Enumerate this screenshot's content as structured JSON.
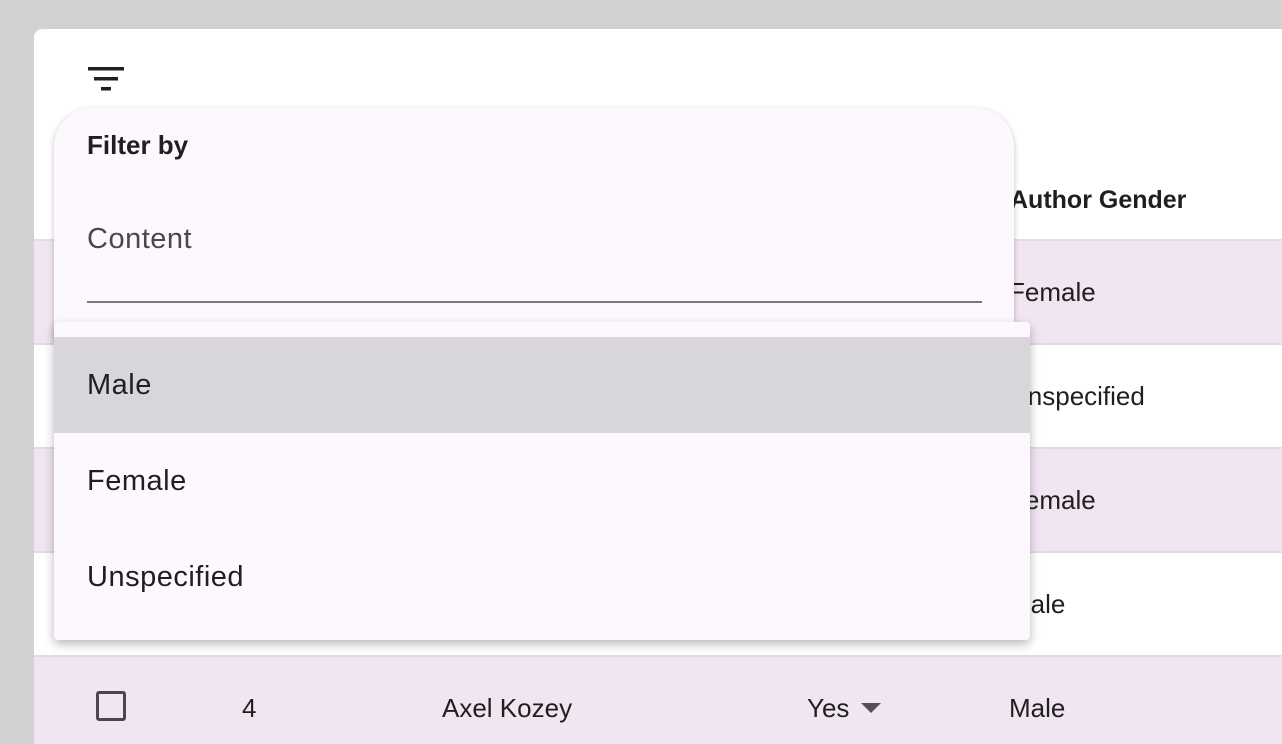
{
  "table": {
    "visible_header": "Author Gender",
    "rows": [
      {
        "gender": "Female"
      },
      {
        "gender": "Unspecified"
      },
      {
        "gender": "Female"
      },
      {
        "gender": "Male"
      },
      {
        "id": "4",
        "author": "Axel Kozey",
        "published": "Yes",
        "gender": "Male"
      }
    ]
  },
  "filter": {
    "icon": "filter-list-icon",
    "title": "Filter by",
    "content_placeholder": "Content"
  },
  "menu": {
    "options": [
      "Male",
      "Female",
      "Unspecified"
    ],
    "highlighted": "Male"
  },
  "colors": {
    "row_tint": "#f1e5f2",
    "panel_bg": "#fcf8fd",
    "highlight": "#d8d6da"
  }
}
